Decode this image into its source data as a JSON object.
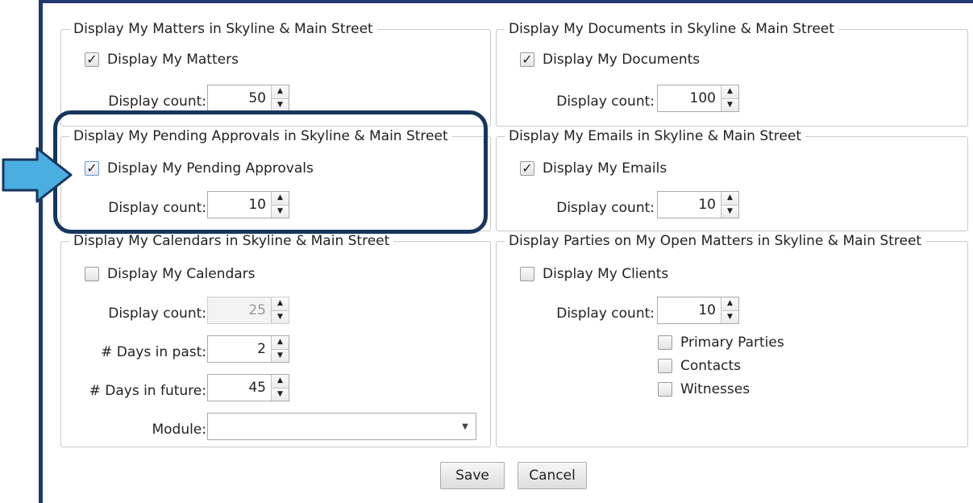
{
  "groups": {
    "matters": {
      "title": "Display My Matters in Skyline & Main Street",
      "checkbox_label": "Display My Matters",
      "checked": true,
      "count_label": "Display count:",
      "count": "50"
    },
    "documents": {
      "title": "Display My Documents in Skyline & Main Street",
      "checkbox_label": "Display My Documents",
      "checked": true,
      "count_label": "Display count:",
      "count": "100"
    },
    "approvals": {
      "title": "Display My Pending Approvals in Skyline & Main Street",
      "checkbox_label": "Display My Pending Approvals",
      "checked": true,
      "count_label": "Display count:",
      "count": "10"
    },
    "emails": {
      "title": "Display My Emails in Skyline & Main Street",
      "checkbox_label": "Display My Emails",
      "checked": true,
      "count_label": "Display count:",
      "count": "10"
    },
    "calendars": {
      "title": "Display My Calendars in Skyline & Main Street",
      "checkbox_label": "Display My Calendars",
      "checked": false,
      "count_label": "Display count:",
      "count": "25",
      "days_past_label": "# Days in past:",
      "days_past": "2",
      "days_future_label": "# Days in future:",
      "days_future": "45",
      "module_label": "Module:",
      "module_value": ""
    },
    "parties": {
      "title": "Display Parties on My Open Matters in Skyline & Main Street",
      "checkbox_label": "Display My Clients",
      "checked": false,
      "count_label": "Display count:",
      "count": "10",
      "options": [
        {
          "label": "Primary Parties",
          "checked": false
        },
        {
          "label": "Contacts",
          "checked": false
        },
        {
          "label": "Witnesses",
          "checked": false
        }
      ]
    }
  },
  "buttons": {
    "save": "Save",
    "cancel": "Cancel"
  },
  "glyphs": {
    "check": "✓",
    "up": "▲",
    "down": "▼",
    "dropdown": "▼"
  },
  "colors": {
    "frame": "#1f3a6e",
    "callout": "#17365d",
    "arrow": "#4aaee0"
  }
}
